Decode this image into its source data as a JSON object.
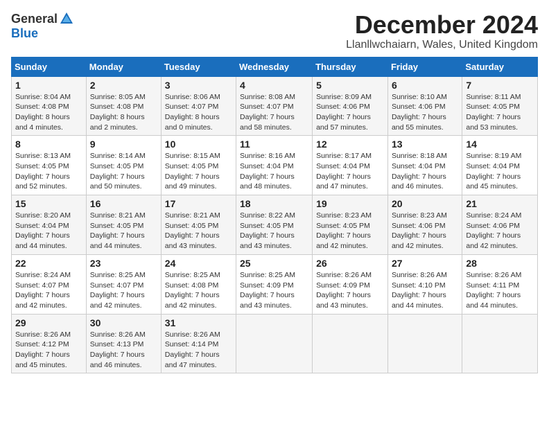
{
  "header": {
    "logo_general": "General",
    "logo_blue": "Blue",
    "title": "December 2024",
    "location": "Llanllwchaiarn, Wales, United Kingdom"
  },
  "weekdays": [
    "Sunday",
    "Monday",
    "Tuesday",
    "Wednesday",
    "Thursday",
    "Friday",
    "Saturday"
  ],
  "weeks": [
    [
      {
        "day": "1",
        "sunrise": "Sunrise: 8:04 AM",
        "sunset": "Sunset: 4:08 PM",
        "daylight": "Daylight: 8 hours and 4 minutes."
      },
      {
        "day": "2",
        "sunrise": "Sunrise: 8:05 AM",
        "sunset": "Sunset: 4:08 PM",
        "daylight": "Daylight: 8 hours and 2 minutes."
      },
      {
        "day": "3",
        "sunrise": "Sunrise: 8:06 AM",
        "sunset": "Sunset: 4:07 PM",
        "daylight": "Daylight: 8 hours and 0 minutes."
      },
      {
        "day": "4",
        "sunrise": "Sunrise: 8:08 AM",
        "sunset": "Sunset: 4:07 PM",
        "daylight": "Daylight: 7 hours and 58 minutes."
      },
      {
        "day": "5",
        "sunrise": "Sunrise: 8:09 AM",
        "sunset": "Sunset: 4:06 PM",
        "daylight": "Daylight: 7 hours and 57 minutes."
      },
      {
        "day": "6",
        "sunrise": "Sunrise: 8:10 AM",
        "sunset": "Sunset: 4:06 PM",
        "daylight": "Daylight: 7 hours and 55 minutes."
      },
      {
        "day": "7",
        "sunrise": "Sunrise: 8:11 AM",
        "sunset": "Sunset: 4:05 PM",
        "daylight": "Daylight: 7 hours and 53 minutes."
      }
    ],
    [
      {
        "day": "8",
        "sunrise": "Sunrise: 8:13 AM",
        "sunset": "Sunset: 4:05 PM",
        "daylight": "Daylight: 7 hours and 52 minutes."
      },
      {
        "day": "9",
        "sunrise": "Sunrise: 8:14 AM",
        "sunset": "Sunset: 4:05 PM",
        "daylight": "Daylight: 7 hours and 50 minutes."
      },
      {
        "day": "10",
        "sunrise": "Sunrise: 8:15 AM",
        "sunset": "Sunset: 4:05 PM",
        "daylight": "Daylight: 7 hours and 49 minutes."
      },
      {
        "day": "11",
        "sunrise": "Sunrise: 8:16 AM",
        "sunset": "Sunset: 4:04 PM",
        "daylight": "Daylight: 7 hours and 48 minutes."
      },
      {
        "day": "12",
        "sunrise": "Sunrise: 8:17 AM",
        "sunset": "Sunset: 4:04 PM",
        "daylight": "Daylight: 7 hours and 47 minutes."
      },
      {
        "day": "13",
        "sunrise": "Sunrise: 8:18 AM",
        "sunset": "Sunset: 4:04 PM",
        "daylight": "Daylight: 7 hours and 46 minutes."
      },
      {
        "day": "14",
        "sunrise": "Sunrise: 8:19 AM",
        "sunset": "Sunset: 4:04 PM",
        "daylight": "Daylight: 7 hours and 45 minutes."
      }
    ],
    [
      {
        "day": "15",
        "sunrise": "Sunrise: 8:20 AM",
        "sunset": "Sunset: 4:04 PM",
        "daylight": "Daylight: 7 hours and 44 minutes."
      },
      {
        "day": "16",
        "sunrise": "Sunrise: 8:21 AM",
        "sunset": "Sunset: 4:05 PM",
        "daylight": "Daylight: 7 hours and 44 minutes."
      },
      {
        "day": "17",
        "sunrise": "Sunrise: 8:21 AM",
        "sunset": "Sunset: 4:05 PM",
        "daylight": "Daylight: 7 hours and 43 minutes."
      },
      {
        "day": "18",
        "sunrise": "Sunrise: 8:22 AM",
        "sunset": "Sunset: 4:05 PM",
        "daylight": "Daylight: 7 hours and 43 minutes."
      },
      {
        "day": "19",
        "sunrise": "Sunrise: 8:23 AM",
        "sunset": "Sunset: 4:05 PM",
        "daylight": "Daylight: 7 hours and 42 minutes."
      },
      {
        "day": "20",
        "sunrise": "Sunrise: 8:23 AM",
        "sunset": "Sunset: 4:06 PM",
        "daylight": "Daylight: 7 hours and 42 minutes."
      },
      {
        "day": "21",
        "sunrise": "Sunrise: 8:24 AM",
        "sunset": "Sunset: 4:06 PM",
        "daylight": "Daylight: 7 hours and 42 minutes."
      }
    ],
    [
      {
        "day": "22",
        "sunrise": "Sunrise: 8:24 AM",
        "sunset": "Sunset: 4:07 PM",
        "daylight": "Daylight: 7 hours and 42 minutes."
      },
      {
        "day": "23",
        "sunrise": "Sunrise: 8:25 AM",
        "sunset": "Sunset: 4:07 PM",
        "daylight": "Daylight: 7 hours and 42 minutes."
      },
      {
        "day": "24",
        "sunrise": "Sunrise: 8:25 AM",
        "sunset": "Sunset: 4:08 PM",
        "daylight": "Daylight: 7 hours and 42 minutes."
      },
      {
        "day": "25",
        "sunrise": "Sunrise: 8:25 AM",
        "sunset": "Sunset: 4:09 PM",
        "daylight": "Daylight: 7 hours and 43 minutes."
      },
      {
        "day": "26",
        "sunrise": "Sunrise: 8:26 AM",
        "sunset": "Sunset: 4:09 PM",
        "daylight": "Daylight: 7 hours and 43 minutes."
      },
      {
        "day": "27",
        "sunrise": "Sunrise: 8:26 AM",
        "sunset": "Sunset: 4:10 PM",
        "daylight": "Daylight: 7 hours and 44 minutes."
      },
      {
        "day": "28",
        "sunrise": "Sunrise: 8:26 AM",
        "sunset": "Sunset: 4:11 PM",
        "daylight": "Daylight: 7 hours and 44 minutes."
      }
    ],
    [
      {
        "day": "29",
        "sunrise": "Sunrise: 8:26 AM",
        "sunset": "Sunset: 4:12 PM",
        "daylight": "Daylight: 7 hours and 45 minutes."
      },
      {
        "day": "30",
        "sunrise": "Sunrise: 8:26 AM",
        "sunset": "Sunset: 4:13 PM",
        "daylight": "Daylight: 7 hours and 46 minutes."
      },
      {
        "day": "31",
        "sunrise": "Sunrise: 8:26 AM",
        "sunset": "Sunset: 4:14 PM",
        "daylight": "Daylight: 7 hours and 47 minutes."
      },
      null,
      null,
      null,
      null
    ]
  ]
}
